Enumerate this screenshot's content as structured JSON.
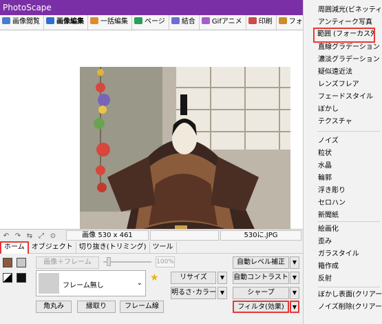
{
  "app": {
    "title": "PhotoScape"
  },
  "tabs": [
    {
      "label": "画像閲覧",
      "color": "#4a7bd0"
    },
    {
      "label": "画像編集",
      "color": "#2e6fd1"
    },
    {
      "label": "一括編集",
      "color": "#e08a2e"
    },
    {
      "label": "ページ",
      "color": "#2b9c5c"
    },
    {
      "label": "結合",
      "color": "#6a6fd6"
    },
    {
      "label": "Gifアニメ",
      "color": "#a85bd1"
    },
    {
      "label": "印刷",
      "color": "#d04a4a"
    },
    {
      "label": "フォトスケープ",
      "color": "#d08a2a"
    }
  ],
  "status": {
    "size": "画像 530 x 461",
    "file": "530に.JPG",
    "icons": [
      "rotate-left-icon",
      "rotate-right-icon",
      "flip-icon",
      "resize-icon",
      "zoom-icon"
    ]
  },
  "ribbon": {
    "tabs": [
      "ホーム",
      "オブジェクト",
      "切り抜き(トリミング)",
      "ツール"
    ],
    "image_frame_label": "画像＋フレーム",
    "percent": "100%",
    "frame_select": "フレーム無し",
    "btn_round": "角丸み",
    "btn_border": "縁取り",
    "btn_frame_line": "フレーム線",
    "btn_resize": "リサイズ",
    "btn_brightness": "明るさ･カラー",
    "btn_auto_level": "自動レベル補正",
    "btn_auto_contrast": "自動コントラスト",
    "btn_sharp": "シャープ",
    "btn_filter": "フィルタ(効果)"
  },
  "menu": {
    "group1": [
      "周囲減光(ビネッティング)",
      "アンティーク写真",
      "範囲 (フォーカス外)",
      "直線グラデーション",
      "濃淡グラデーション",
      "疑似遠近法",
      "レンズフレア",
      "フェードスタイル",
      "ぼかし",
      "テクスチャ"
    ],
    "group2": [
      "ノイズ",
      "粒状",
      "水晶",
      "輪郭",
      "浮き彫り",
      "セロハン",
      "新聞紙"
    ],
    "group3": [
      "絵画化",
      "歪み",
      "ガラスタイル",
      "箱作成",
      "反射"
    ],
    "group4": [
      "ぼかし表面(クリアースキン)",
      "ノイズ削除(クリアースキン)"
    ],
    "highlight_color": "#e53935"
  }
}
